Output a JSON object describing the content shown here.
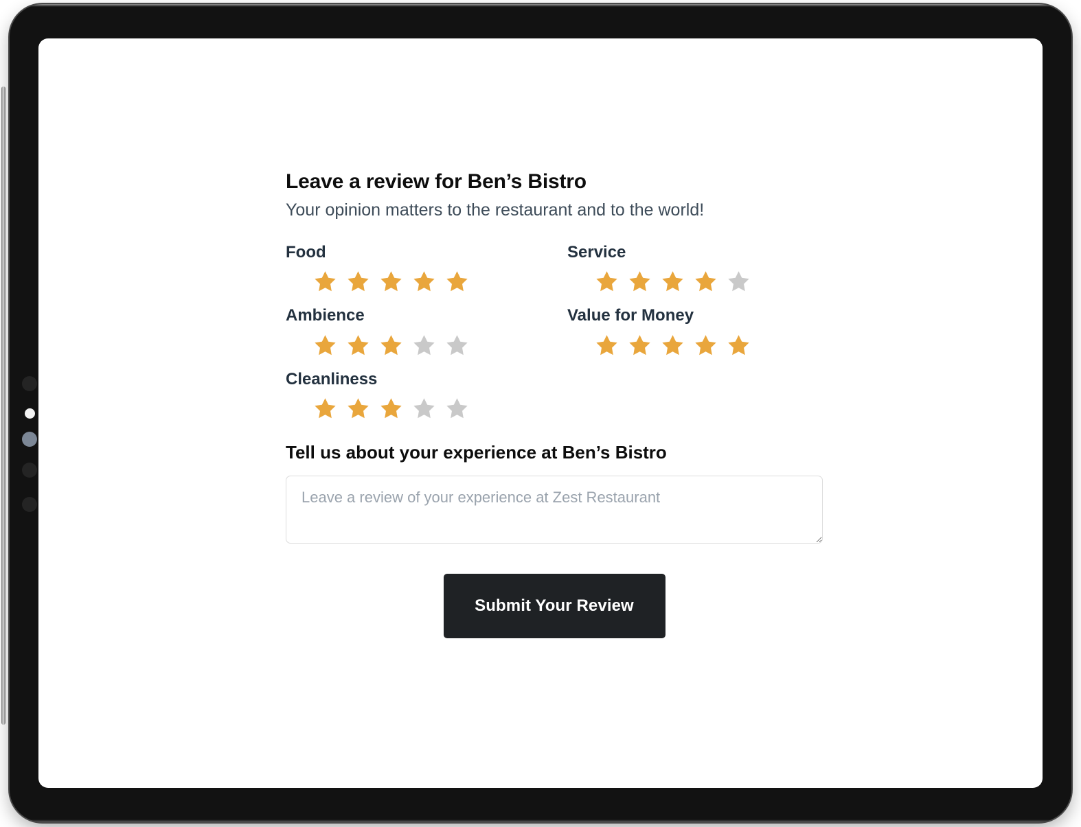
{
  "device": {
    "type": "tablet",
    "frame_color": "#121212",
    "screen_background": "#ffffff",
    "bezel_dots": [
      {
        "name": "bezel-dot-1",
        "state": "off",
        "color": "#242424"
      },
      {
        "name": "bezel-dot-2",
        "state": "lit-white",
        "color": "#f2f2f2"
      },
      {
        "name": "bezel-dot-3",
        "state": "lit-blue",
        "color": "#7c8796"
      },
      {
        "name": "bezel-dot-4",
        "state": "off",
        "color": "#242424"
      },
      {
        "name": "bezel-dot-5",
        "state": "off",
        "color": "#242424"
      }
    ]
  },
  "colors": {
    "star_active": "#e9a63c",
    "star_inactive": "#c9c9c9",
    "button_background": "#1f2225",
    "button_text": "#ffffff",
    "heading_text": "#0d0d0d",
    "label_text": "#23313f",
    "subtitle_text": "#3e4c59",
    "placeholder_text": "#9aa3ad",
    "input_border": "#dcdcdc"
  },
  "form": {
    "title": "Leave a review for Ben’s Bistro",
    "subtitle": "Your opinion matters to the restaurant and to the world!",
    "max_rating": 5,
    "ratings": [
      {
        "id": "food",
        "label": "Food",
        "value": 5
      },
      {
        "id": "service",
        "label": "Service",
        "value": 4
      },
      {
        "id": "ambience",
        "label": "Ambience",
        "value": 3
      },
      {
        "id": "value-for-money",
        "label": "Value for Money",
        "value": 5
      },
      {
        "id": "cleanliness",
        "label": "Cleanliness",
        "value": 3
      }
    ],
    "experience_heading": "Tell us about your experience at Ben’s Bistro",
    "textarea": {
      "placeholder": "Leave a review of your experience at Zest Restaurant",
      "value": ""
    },
    "submit_label": "Submit Your Review"
  }
}
